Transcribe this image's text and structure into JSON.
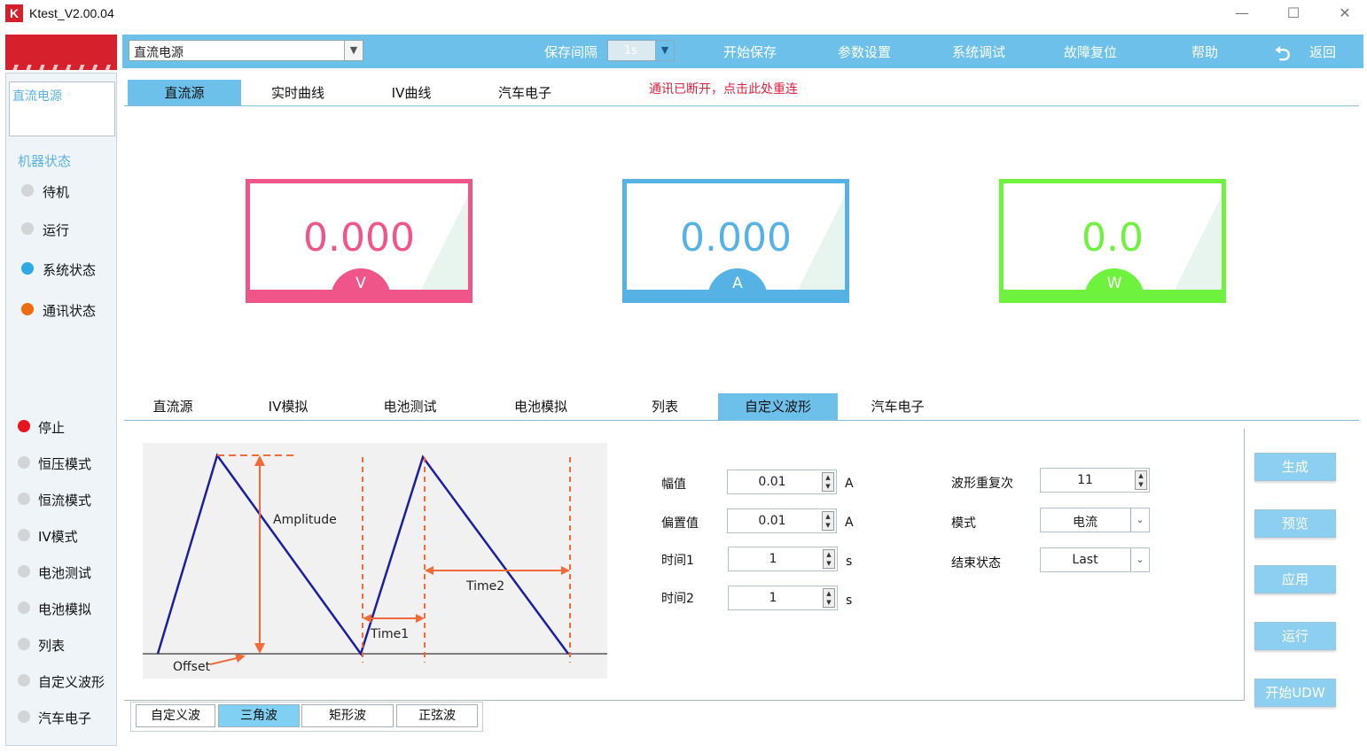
{
  "window": {
    "title": "Ktest_V2.00.04",
    "logo_letter": "K",
    "controls": {
      "minimize": "—",
      "maximize": "☐",
      "close": "✕"
    }
  },
  "toolbar": {
    "source_value": "直流电源",
    "save_interval_label": "保存间隔",
    "save_interval_value": "1s",
    "start_save": "开始保存",
    "param_settings": "参数设置",
    "system_debug": "系统调试",
    "fault_reset": "故障复位",
    "help": "帮助",
    "back": "返回"
  },
  "sidebar": {
    "title": "直流电源",
    "machine_state_title": "机器状态",
    "states": [
      {
        "label": "待机",
        "color": "#d2d4d6"
      },
      {
        "label": "运行",
        "color": "#d2d4d6"
      },
      {
        "label": "系统状态",
        "color": "#2fa8e8"
      },
      {
        "label": "通讯状态",
        "color": "#f06a10"
      }
    ],
    "modes": [
      {
        "label": "停止",
        "color": "#e8141e"
      },
      {
        "label": "恒压模式",
        "color": "#d2d4d6"
      },
      {
        "label": "恒流模式",
        "color": "#d2d4d6"
      },
      {
        "label": "IV模式",
        "color": "#d2d4d6"
      },
      {
        "label": "电池测试",
        "color": "#d2d4d6"
      },
      {
        "label": "电池模拟",
        "color": "#d2d4d6"
      },
      {
        "label": "列表",
        "color": "#d2d4d6"
      },
      {
        "label": "自定义波形",
        "color": "#d2d4d6"
      },
      {
        "label": "汽车电子",
        "color": "#d2d4d6"
      }
    ]
  },
  "top_tabs": [
    "直流源",
    "实时曲线",
    "IV曲线",
    "汽车电子"
  ],
  "top_tab_active": 0,
  "connection_message": "通讯已断开，点击此处重连",
  "meters": [
    {
      "value": "0.000",
      "unit": "V",
      "color": "#f0558a"
    },
    {
      "value": "0.000",
      "unit": "A",
      "color": "#56b2e4"
    },
    {
      "value": "0.0",
      "unit": "W",
      "color": "#6ef23e"
    }
  ],
  "bottom_tabs": [
    "直流源",
    "IV模拟",
    "电池测试",
    "电池模拟",
    "列表",
    "自定义波形",
    "汽车电子"
  ],
  "bottom_tab_active": 5,
  "wave_diagram": {
    "amplitude": "Amplitude",
    "time1": "Time1",
    "time2": "Time2",
    "offset": "Offset"
  },
  "params": {
    "amplitude": {
      "label": "幅值",
      "value": "0.01",
      "unit": "A"
    },
    "offset": {
      "label": "偏置值",
      "value": "0.01",
      "unit": "A"
    },
    "time1": {
      "label": "时间1",
      "value": "1",
      "unit": "s"
    },
    "time2": {
      "label": "时间2",
      "value": "1",
      "unit": "s"
    },
    "repeat": {
      "label": "波形重复次",
      "value": "11"
    },
    "mode": {
      "label": "模式",
      "value": "电流"
    },
    "end_state": {
      "label": "结束状态",
      "value": "Last"
    }
  },
  "actions": [
    "生成",
    "预览",
    "应用",
    "运行",
    "开始UDW"
  ],
  "wave_types": [
    "自定义波",
    "三角波",
    "矩形波",
    "正弦波"
  ],
  "wave_type_active": 1
}
